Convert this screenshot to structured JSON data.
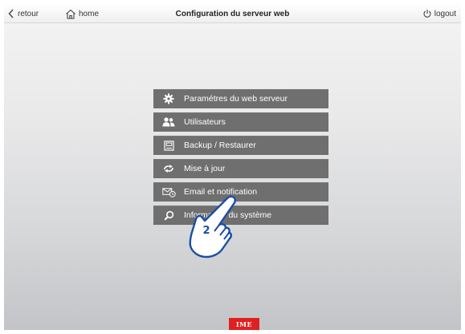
{
  "topbar": {
    "back_label": "retour",
    "home_label": "home",
    "title": "Configuration du serveur web",
    "logout_label": "logout"
  },
  "menu": {
    "items": [
      {
        "label": "Paramétres du web serveur",
        "icon": "gear-icon"
      },
      {
        "label": "Utilisateurs",
        "icon": "users-icon"
      },
      {
        "label": "Backup / Restaurer",
        "icon": "backup-disk-icon"
      },
      {
        "label": "Mise à jour",
        "icon": "update-refresh-icon"
      },
      {
        "label": "Email et notification",
        "icon": "email-notification-icon"
      },
      {
        "label": "Information du système",
        "icon": "magnifier-icon"
      }
    ]
  },
  "callout": {
    "step_number": "2",
    "icon": "pointing-hand-icon"
  },
  "footer": {
    "logo_text": "IME"
  },
  "colors": {
    "menu_item_bg": "#6f6f70",
    "menu_item_text": "#ffffff",
    "logo_bg": "#e02020",
    "hand_outline": "#1a4fa3"
  }
}
